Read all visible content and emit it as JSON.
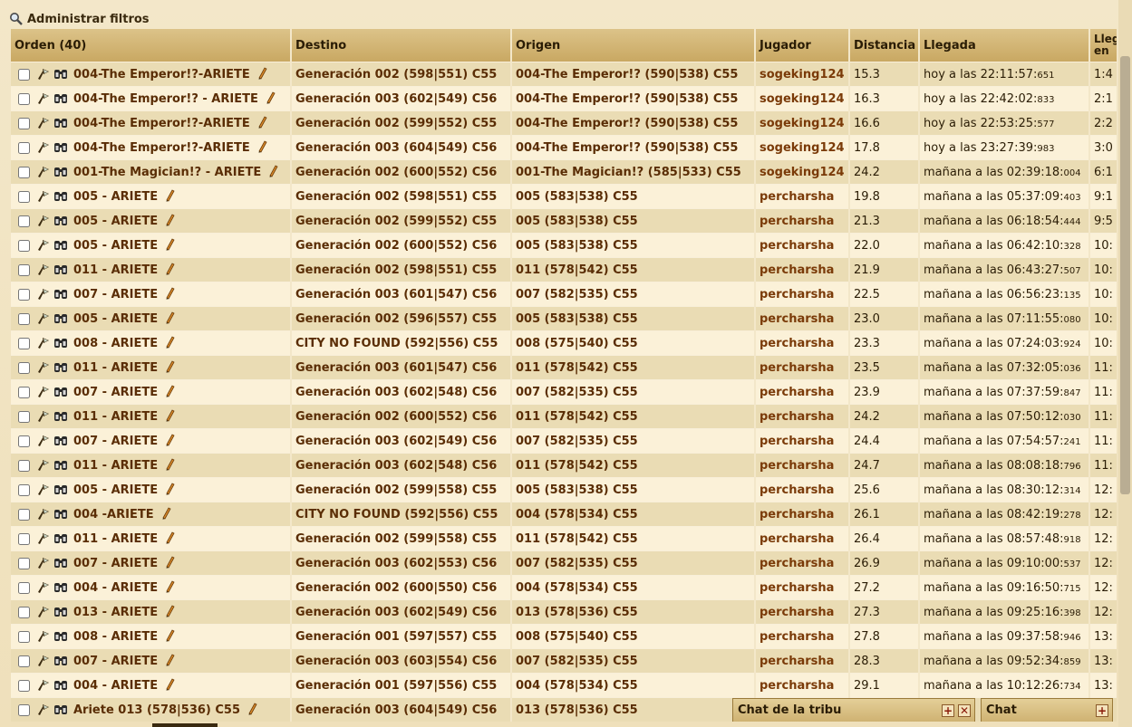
{
  "filters": {
    "label": "Administrar filtros"
  },
  "table": {
    "headers": {
      "order": "Orden (40)",
      "destination": "Destino",
      "origin": "Origen",
      "player": "Jugador",
      "distance": "Distancia",
      "arrival": "Llegada",
      "arrives_in": "Lleg en"
    },
    "rows": [
      {
        "order": "004-The Emperor!?-ARIETE",
        "dest": "Generación 002 (598|551) C55",
        "orig": "004-The Emperor!? (590|538) C55",
        "player": "sogeking124",
        "dist": "15.3",
        "arr": "hoy a las 22:11:57:",
        "ms": "651",
        "in": "1:4"
      },
      {
        "order": "004-The Emperor!? - ARIETE",
        "dest": "Generación 003 (602|549) C56",
        "orig": "004-The Emperor!? (590|538) C55",
        "player": "sogeking124",
        "dist": "16.3",
        "arr": "hoy a las 22:42:02:",
        "ms": "833",
        "in": "2:1"
      },
      {
        "order": "004-The Emperor!?-ARIETE",
        "dest": "Generación 002 (599|552) C55",
        "orig": "004-The Emperor!? (590|538) C55",
        "player": "sogeking124",
        "dist": "16.6",
        "arr": "hoy a las 22:53:25:",
        "ms": "577",
        "in": "2:2"
      },
      {
        "order": "004-The Emperor!?-ARIETE",
        "dest": "Generación 003 (604|549) C56",
        "orig": "004-The Emperor!? (590|538) C55",
        "player": "sogeking124",
        "dist": "17.8",
        "arr": "hoy a las 23:27:39:",
        "ms": "983",
        "in": "3:0"
      },
      {
        "order": "001-The Magician!? - ARIETE",
        "dest": "Generación 002 (600|552) C56",
        "orig": "001-The Magician!? (585|533) C55",
        "player": "sogeking124",
        "dist": "24.2",
        "arr": "mañana a las 02:39:18:",
        "ms": "004",
        "in": "6:1"
      },
      {
        "order": "005 - ARIETE",
        "dest": "Generación 002 (598|551) C55",
        "orig": "005 (583|538) C55",
        "player": "percharsha",
        "dist": "19.8",
        "arr": "mañana a las 05:37:09:",
        "ms": "403",
        "in": "9:1"
      },
      {
        "order": "005 - ARIETE",
        "dest": "Generación 002 (599|552) C55",
        "orig": "005 (583|538) C55",
        "player": "percharsha",
        "dist": "21.3",
        "arr": "mañana a las 06:18:54:",
        "ms": "444",
        "in": "9:5"
      },
      {
        "order": "005 - ARIETE",
        "dest": "Generación 002 (600|552) C56",
        "orig": "005 (583|538) C55",
        "player": "percharsha",
        "dist": "22.0",
        "arr": "mañana a las 06:42:10:",
        "ms": "328",
        "in": "10:"
      },
      {
        "order": "011 - ARIETE",
        "dest": "Generación 002 (598|551) C55",
        "orig": "011 (578|542) C55",
        "player": "percharsha",
        "dist": "21.9",
        "arr": "mañana a las 06:43:27:",
        "ms": "507",
        "in": "10:"
      },
      {
        "order": "007 - ARIETE",
        "dest": "Generación 003 (601|547) C56",
        "orig": "007 (582|535) C55",
        "player": "percharsha",
        "dist": "22.5",
        "arr": "mañana a las 06:56:23:",
        "ms": "135",
        "in": "10:"
      },
      {
        "order": "005 - ARIETE",
        "dest": "Generación 002 (596|557) C55",
        "orig": "005 (583|538) C55",
        "player": "percharsha",
        "dist": "23.0",
        "arr": "mañana a las 07:11:55:",
        "ms": "080",
        "in": "10:"
      },
      {
        "order": "008 - ARIETE",
        "dest": "CITY NO FOUND (592|556) C55",
        "orig": "008 (575|540) C55",
        "player": "percharsha",
        "dist": "23.3",
        "arr": "mañana a las 07:24:03:",
        "ms": "924",
        "in": "10:"
      },
      {
        "order": "011 - ARIETE",
        "dest": "Generación 003 (601|547) C56",
        "orig": "011 (578|542) C55",
        "player": "percharsha",
        "dist": "23.5",
        "arr": "mañana a las 07:32:05:",
        "ms": "036",
        "in": "11:"
      },
      {
        "order": "007 - ARIETE",
        "dest": "Generación 003 (602|548) C56",
        "orig": "007 (582|535) C55",
        "player": "percharsha",
        "dist": "23.9",
        "arr": "mañana a las 07:37:59:",
        "ms": "847",
        "in": "11:"
      },
      {
        "order": "011 - ARIETE",
        "dest": "Generación 002 (600|552) C56",
        "orig": "011 (578|542) C55",
        "player": "percharsha",
        "dist": "24.2",
        "arr": "mañana a las 07:50:12:",
        "ms": "030",
        "in": "11:"
      },
      {
        "order": "007 - ARIETE",
        "dest": "Generación 003 (602|549) C56",
        "orig": "007 (582|535) C55",
        "player": "percharsha",
        "dist": "24.4",
        "arr": "mañana a las 07:54:57:",
        "ms": "241",
        "in": "11:"
      },
      {
        "order": "011 - ARIETE",
        "dest": "Generación 003 (602|548) C56",
        "orig": "011 (578|542) C55",
        "player": "percharsha",
        "dist": "24.7",
        "arr": "mañana a las 08:08:18:",
        "ms": "796",
        "in": "11:"
      },
      {
        "order": "005 - ARIETE",
        "dest": "Generación 002 (599|558) C55",
        "orig": "005 (583|538) C55",
        "player": "percharsha",
        "dist": "25.6",
        "arr": "mañana a las 08:30:12:",
        "ms": "314",
        "in": "12:"
      },
      {
        "order": "004 -ARIETE",
        "dest": "CITY NO FOUND (592|556) C55",
        "orig": "004 (578|534) C55",
        "player": "percharsha",
        "dist": "26.1",
        "arr": "mañana a las 08:42:19:",
        "ms": "278",
        "in": "12:"
      },
      {
        "order": "011 - ARIETE",
        "dest": "Generación 002 (599|558) C55",
        "orig": "011 (578|542) C55",
        "player": "percharsha",
        "dist": "26.4",
        "arr": "mañana a las 08:57:48:",
        "ms": "918",
        "in": "12:"
      },
      {
        "order": "007 - ARIETE",
        "dest": "Generación 003 (602|553) C56",
        "orig": "007 (582|535) C55",
        "player": "percharsha",
        "dist": "26.9",
        "arr": "mañana a las 09:10:00:",
        "ms": "537",
        "in": "12:"
      },
      {
        "order": "004 - ARIETE",
        "dest": "Generación 002 (600|550) C56",
        "orig": "004 (578|534) C55",
        "player": "percharsha",
        "dist": "27.2",
        "arr": "mañana a las 09:16:50:",
        "ms": "715",
        "in": "12:"
      },
      {
        "order": "013 - ARIETE",
        "dest": "Generación 003 (602|549) C56",
        "orig": "013 (578|536) C55",
        "player": "percharsha",
        "dist": "27.3",
        "arr": "mañana a las 09:25:16:",
        "ms": "398",
        "in": "12:"
      },
      {
        "order": "008 - ARIETE",
        "dest": "Generación 001 (597|557) C55",
        "orig": "008 (575|540) C55",
        "player": "percharsha",
        "dist": "27.8",
        "arr": "mañana a las 09:37:58:",
        "ms": "946",
        "in": "13:"
      },
      {
        "order": "007 - ARIETE",
        "dest": "Generación 003 (603|554) C56",
        "orig": "007 (582|535) C55",
        "player": "percharsha",
        "dist": "28.3",
        "arr": "mañana a las 09:52:34:",
        "ms": "859",
        "in": "13:"
      },
      {
        "order": "004 - ARIETE",
        "dest": "Generación 001 (597|556) C55",
        "orig": "004 (578|534) C55",
        "player": "percharsha",
        "dist": "29.1",
        "arr": "mañana a las 10:12:26:",
        "ms": "734",
        "in": "13:"
      },
      {
        "order": "Ariete 013 (578|536) C55",
        "dest": "Generación 003 (604|549) C56",
        "orig": "013 (578|536) C55",
        "player": "",
        "dist": "",
        "arr": "",
        "ms": "",
        "in": ""
      }
    ]
  },
  "chats": {
    "tribe": {
      "title": "Chat de la tribu",
      "maximize": "+",
      "close": "✕"
    },
    "main": {
      "title": "Chat",
      "maximize": "+"
    }
  },
  "icons": [
    "magnifier-icon",
    "attack-command-icon",
    "binoculars-icon",
    "edit-pencil-icon"
  ]
}
